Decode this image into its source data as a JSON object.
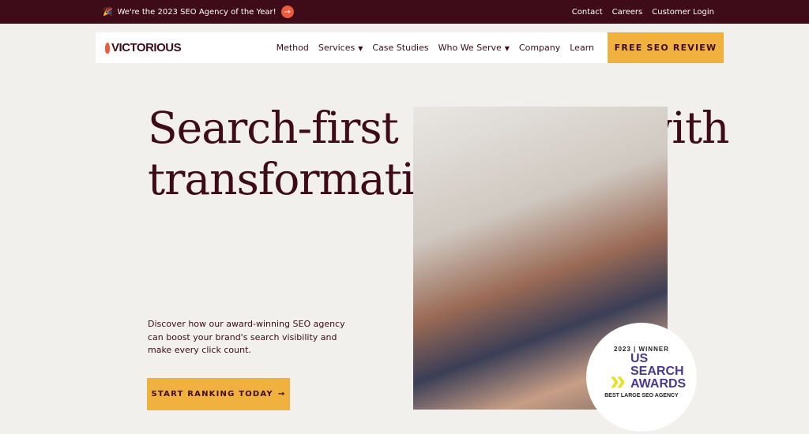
{
  "topbar": {
    "announcement": "We're the 2023 SEO Agency of the Year!",
    "links": [
      "Contact",
      "Careers",
      "Customer Login"
    ]
  },
  "nav": {
    "logo": "VICTORIOUS",
    "items": [
      {
        "label": "Method"
      },
      {
        "label": "Services",
        "dropdown": true
      },
      {
        "label": "Case Studies"
      },
      {
        "label": "Who We Serve",
        "dropdown": true
      },
      {
        "label": "Company"
      },
      {
        "label": "Learn"
      }
    ],
    "cta": "FREE SEO REVIEW"
  },
  "hero": {
    "headline": "Search-first strategies with transformative results.",
    "description": "Discover how our award-winning SEO agency can boost your brand's search visibility and make every click count.",
    "button": "START RANKING TODAY",
    "button_icon": "→"
  },
  "badge": {
    "year": "2023 | WINNER",
    "title_lines": [
      "US",
      "SEARCH",
      "AWARDS"
    ],
    "subtitle": "BEST LARGE SEO AGENCY"
  },
  "colors": {
    "brand": "#3d0c18",
    "accent": "#f0b13f",
    "arrow": "#ea5b3f"
  }
}
